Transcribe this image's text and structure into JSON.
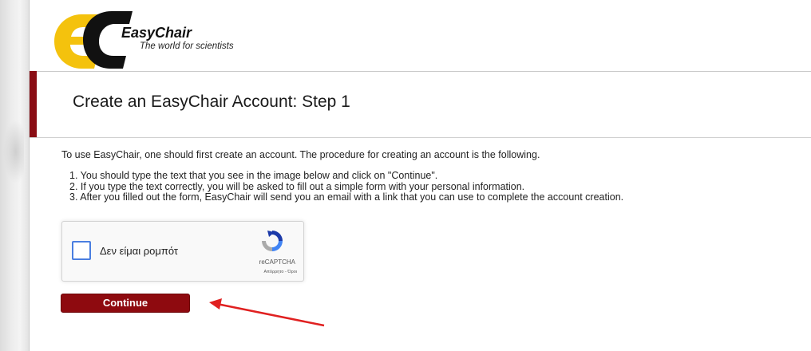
{
  "logo": {
    "name": "EasyChair",
    "tagline": "The world for scientists"
  },
  "page": {
    "title": "Create an EasyChair Account: Step 1",
    "intro": "To use EasyChair, one should first create an account. The procedure for creating an account is the following.",
    "steps": [
      "1. You should type the text that you see in the image below and click on \"Continue\".",
      "2. If you type the text correctly, you will be asked to fill out a simple form with your personal information.",
      "3. After you filled out the form, EasyChair will send you an email with a link that you can use to complete the account creation."
    ]
  },
  "recaptcha": {
    "label": "Δεν είμαι ρομπότ",
    "brand": "reCAPTCHA",
    "terms": "Απόρρητο - Όροι",
    "checked": false
  },
  "form": {
    "continue_label": "Continue"
  },
  "colors": {
    "accent": "#8e0a0f",
    "checkbox_border": "#4a7ee0",
    "annotation_arrow": "#e02020"
  }
}
